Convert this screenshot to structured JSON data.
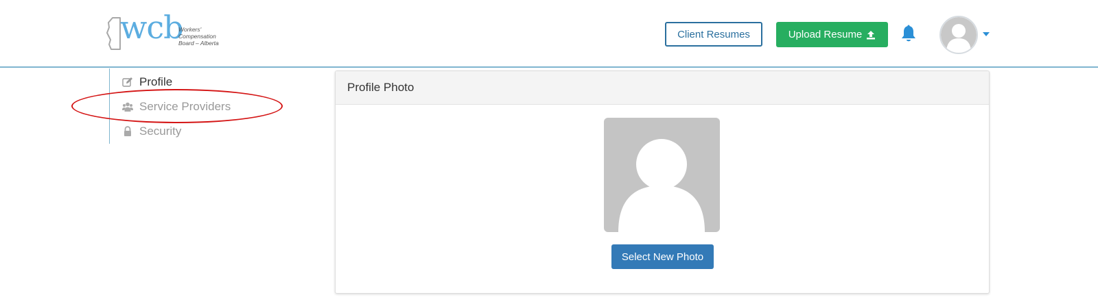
{
  "logo": {
    "mark": "wcb",
    "sub_lines": [
      "Workers'",
      "Compensation",
      "Board – Alberta"
    ]
  },
  "header": {
    "client_resumes_label": "Client Resumes",
    "upload_resume_label": "Upload Resume",
    "icons": {
      "upload": "upload-icon",
      "bell": "bell-icon",
      "avatar": "user-avatar-icon",
      "caret": "caret-down-icon"
    }
  },
  "sidebar": {
    "items": [
      {
        "label": "Profile",
        "icon": "edit-icon",
        "active": true
      },
      {
        "label": "Service Providers",
        "icon": "users-icon",
        "active": false
      },
      {
        "label": "Security",
        "icon": "lock-icon",
        "active": false
      }
    ]
  },
  "annotation": {
    "color": "#d41414",
    "target": "Service Providers"
  },
  "panel": {
    "title": "Profile Photo",
    "select_photo_label": "Select New Photo",
    "placeholder_icon": "default-user-icon"
  },
  "colors": {
    "accent_blue": "#2a6f9e",
    "upload_green": "#27ae60",
    "select_blue": "#337ab7",
    "bell_blue": "#2b8fd6",
    "logo_blue": "#5cade0",
    "divider": "#7fb5cf"
  }
}
